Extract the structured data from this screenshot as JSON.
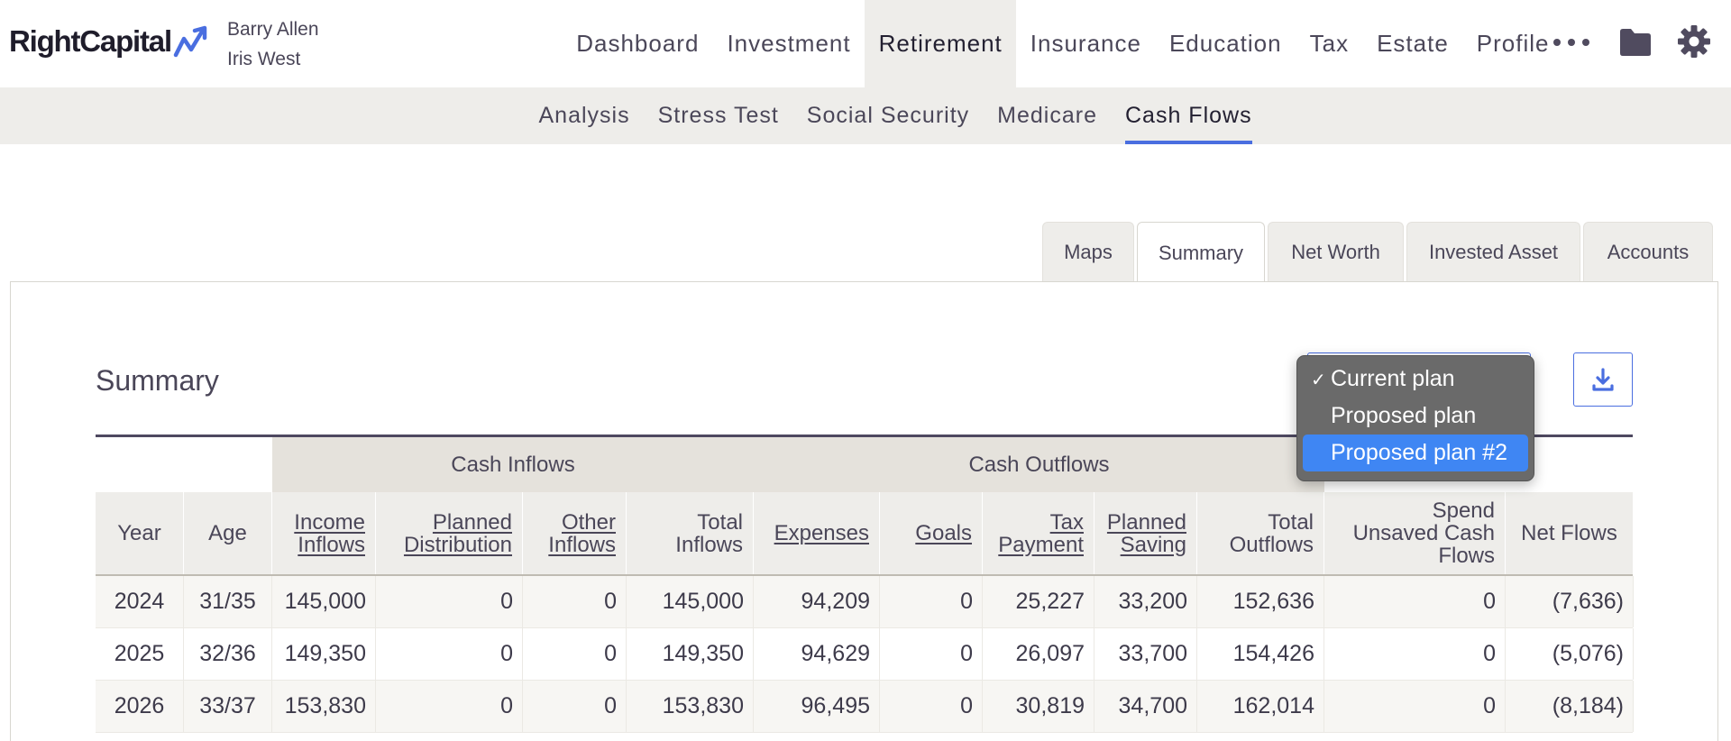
{
  "brand": {
    "name": "RightCapital"
  },
  "clients": [
    "Barry Allen",
    "Iris West"
  ],
  "main_nav": [
    {
      "label": "Dashboard",
      "active": false
    },
    {
      "label": "Investment",
      "active": false
    },
    {
      "label": "Retirement",
      "active": true
    },
    {
      "label": "Insurance",
      "active": false
    },
    {
      "label": "Education",
      "active": false
    },
    {
      "label": "Tax",
      "active": false
    },
    {
      "label": "Estate",
      "active": false
    },
    {
      "label": "Profile",
      "active": false
    }
  ],
  "header_icons": [
    "more-icon",
    "folder-icon",
    "gear-icon"
  ],
  "sub_nav": [
    {
      "label": "Analysis",
      "active": false
    },
    {
      "label": "Stress Test",
      "active": false
    },
    {
      "label": "Social Security",
      "active": false
    },
    {
      "label": "Medicare",
      "active": false
    },
    {
      "label": "Cash Flows",
      "active": true
    }
  ],
  "view_tabs": [
    {
      "label": "Maps",
      "active": false
    },
    {
      "label": "Summary",
      "active": true
    },
    {
      "label": "Net Worth",
      "active": false
    },
    {
      "label": "Invested Asset",
      "active": false
    },
    {
      "label": "Accounts",
      "active": false
    }
  ],
  "section_title": "Summary",
  "plan_menu": {
    "options": [
      "Current plan",
      "Proposed plan",
      "Proposed plan #2"
    ],
    "selected": "Current plan",
    "highlighted": "Proposed plan #2",
    "check_mark": "✓"
  },
  "download_icon": "download-icon",
  "table": {
    "groups": [
      {
        "label": "",
        "span": [
          0,
          1
        ]
      },
      {
        "label": "Cash Inflows",
        "span": [
          2,
          5
        ]
      },
      {
        "label": "Cash Outflows",
        "span": [
          6,
          10
        ]
      },
      {
        "label": "",
        "span": [
          11,
          12
        ]
      }
    ],
    "columns": [
      {
        "label": "Year",
        "link": false,
        "align": "center"
      },
      {
        "label": "Age",
        "link": false,
        "align": "center"
      },
      {
        "label": "Income\nInflows",
        "link": true,
        "align": "right"
      },
      {
        "label": "Planned\nDistribution",
        "link": true,
        "align": "right"
      },
      {
        "label": "Other\nInflows",
        "link": true,
        "align": "right"
      },
      {
        "label": "Total\nInflows",
        "link": false,
        "align": "right"
      },
      {
        "label": "Expenses",
        "link": true,
        "align": "right"
      },
      {
        "label": "Goals",
        "link": true,
        "align": "right"
      },
      {
        "label": "Tax\nPayment",
        "link": true,
        "align": "right"
      },
      {
        "label": "Planned\nSaving",
        "link": true,
        "align": "right"
      },
      {
        "label": "Total\nOutflows",
        "link": false,
        "align": "right"
      },
      {
        "label": "Spend\nUnsaved Cash\nFlows",
        "link": false,
        "align": "right"
      },
      {
        "label": "Net Flows",
        "link": false,
        "align": "center"
      }
    ],
    "rows": [
      [
        "2024",
        "31/35",
        "145,000",
        "0",
        "0",
        "145,000",
        "94,209",
        "0",
        "25,227",
        "33,200",
        "152,636",
        "0",
        "(7,636)"
      ],
      [
        "2025",
        "32/36",
        "149,350",
        "0",
        "0",
        "149,350",
        "94,629",
        "0",
        "26,097",
        "33,700",
        "154,426",
        "0",
        "(5,076)"
      ],
      [
        "2026",
        "33/37",
        "153,830",
        "0",
        "0",
        "153,830",
        "96,495",
        "0",
        "30,819",
        "34,700",
        "162,014",
        "0",
        "(8,184)"
      ]
    ]
  }
}
